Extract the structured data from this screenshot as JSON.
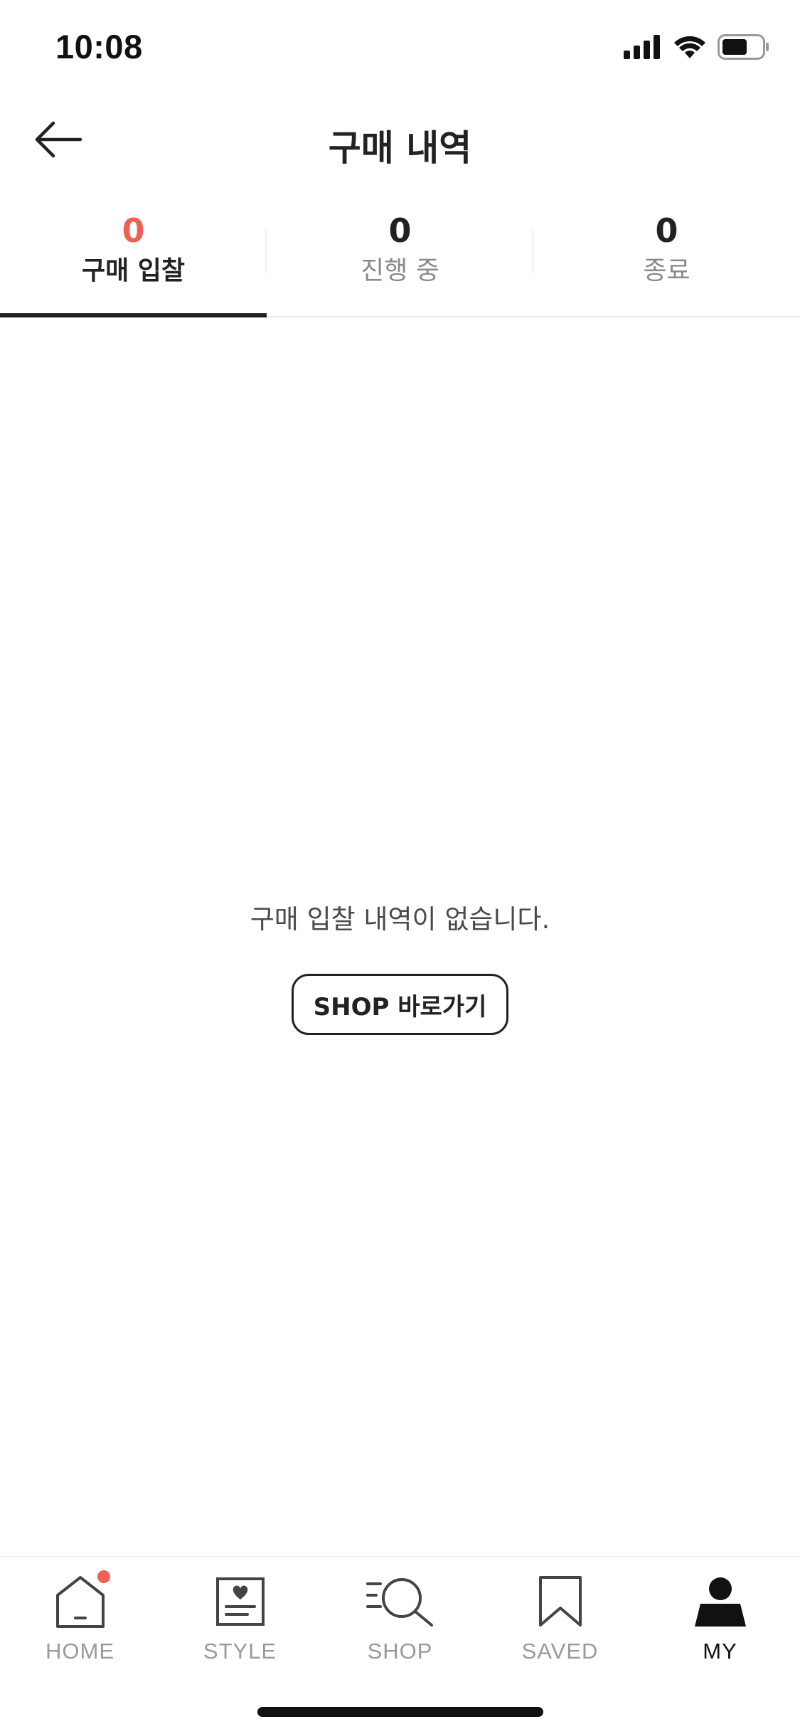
{
  "status_bar": {
    "time": "10:08"
  },
  "header": {
    "title": "구매 내역"
  },
  "tabs": [
    {
      "count": "0",
      "label": "구매 입찰",
      "active": true
    },
    {
      "count": "0",
      "label": "진행 중",
      "active": false
    },
    {
      "count": "0",
      "label": "종료",
      "active": false
    }
  ],
  "empty_state": {
    "message": "구매 입찰 내역이 없습니다.",
    "button_label": "SHOP 바로가기"
  },
  "bottom_nav": {
    "items": [
      {
        "label": "HOME",
        "icon": "home-icon",
        "active": false,
        "badge": true
      },
      {
        "label": "STYLE",
        "icon": "style-icon",
        "active": false,
        "badge": false
      },
      {
        "label": "SHOP",
        "icon": "shop-search-icon",
        "active": false,
        "badge": false
      },
      {
        "label": "SAVED",
        "icon": "bookmark-icon",
        "active": false,
        "badge": false
      },
      {
        "label": "MY",
        "icon": "profile-icon",
        "active": true,
        "badge": false
      }
    ]
  },
  "colors": {
    "accent": "#ef6253",
    "text_primary": "#222222",
    "text_muted": "#8a8a8a"
  }
}
